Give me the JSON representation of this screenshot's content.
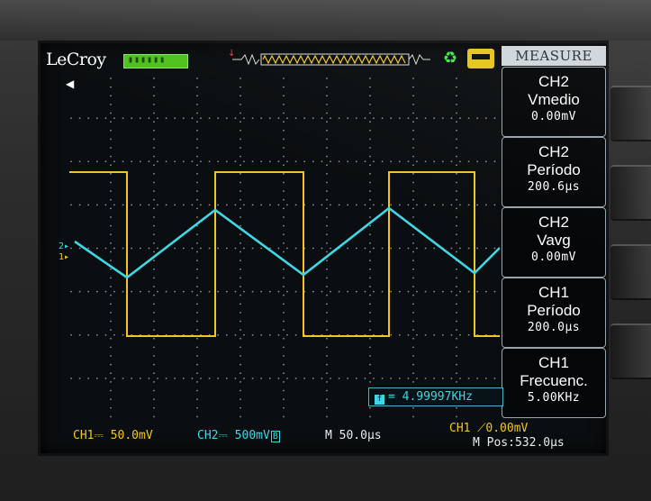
{
  "device": {
    "brand": "LeCroy",
    "menu_title": "MEASURE"
  },
  "measurements": [
    {
      "channel": "CH2",
      "name": "Vmedio",
      "value": "0.00mV"
    },
    {
      "channel": "CH2",
      "name": "Período",
      "value": "200.6µs"
    },
    {
      "channel": "CH2",
      "name": "Vavg",
      "value": "0.00mV"
    },
    {
      "channel": "CH1",
      "name": "Período",
      "value": "200.0µs"
    },
    {
      "channel": "CH1",
      "name": "Frecuenc.",
      "value": "5.00KHz"
    }
  ],
  "frequency_counter": "= 4.99997KHz",
  "status": {
    "ch1": "CH1⎓ 50.0mV",
    "ch2": "CH2⎓ 500mV",
    "ch2_bw": "B",
    "timebase": "M 50.0µs",
    "trigger": "CH1 ⟋0.00mV",
    "mpos": "M Pos:532.0µs"
  },
  "channel_markers": {
    "ch2": "2▸",
    "ch1": "1▸"
  },
  "colors": {
    "ch1": "#f1c623",
    "ch2": "#3fd6e6",
    "grid": "#8a9096",
    "screen": "#0b0e10"
  },
  "icons": {
    "run": "run-recycle-icon",
    "save": "save-printer-icon",
    "trigger": "trigger-marker-icon"
  }
}
